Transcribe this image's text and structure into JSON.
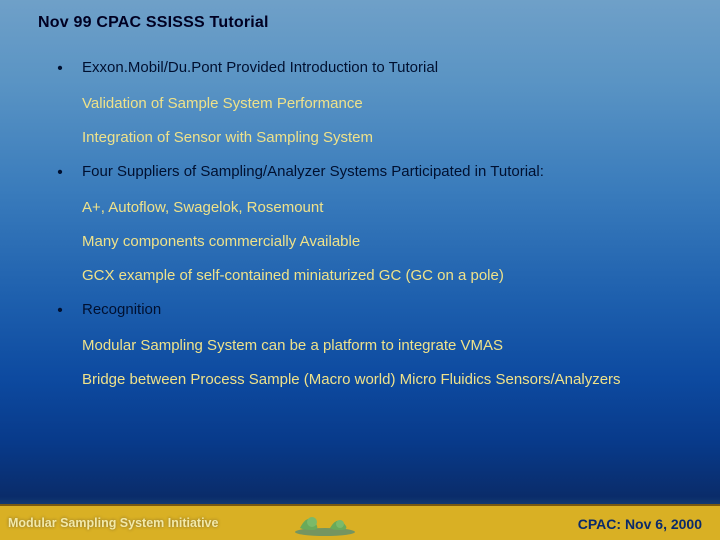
{
  "title": "Nov 99 CPAC SSISSS Tutorial",
  "items": [
    {
      "bullet": "•",
      "lead": true,
      "text": "Exxon.Mobil/Du.Pont Provided Introduction to Tutorial"
    },
    {
      "bullet": "",
      "lead": false,
      "text": "Validation of Sample System Performance"
    },
    {
      "bullet": "",
      "lead": false,
      "text": "Integration of Sensor with Sampling System"
    },
    {
      "bullet": "•",
      "lead": true,
      "text": "Four Suppliers of Sampling/Analyzer Systems Participated in Tutorial:"
    },
    {
      "bullet": "",
      "lead": false,
      "text": "A+, Autoflow, Swagelok, Rosemount"
    },
    {
      "bullet": "",
      "lead": false,
      "text": "Many components commercially Available"
    },
    {
      "bullet": "",
      "lead": false,
      "text": "GCX example of self-contained miniaturized GC (GC on a pole)"
    },
    {
      "bullet": "•",
      "lead": true,
      "text": "Recognition"
    },
    {
      "bullet": "",
      "lead": false,
      "text": "Modular Sampling System can be a platform to integrate VMAS"
    },
    {
      "bullet": "",
      "lead": false,
      "text": "Bridge between Process Sample (Macro world) Micro Fluidics Sensors/Analyzers"
    }
  ],
  "footer": {
    "left": "Modular Sampling System Initiative",
    "right": "CPAC: Nov 6, 2000"
  }
}
